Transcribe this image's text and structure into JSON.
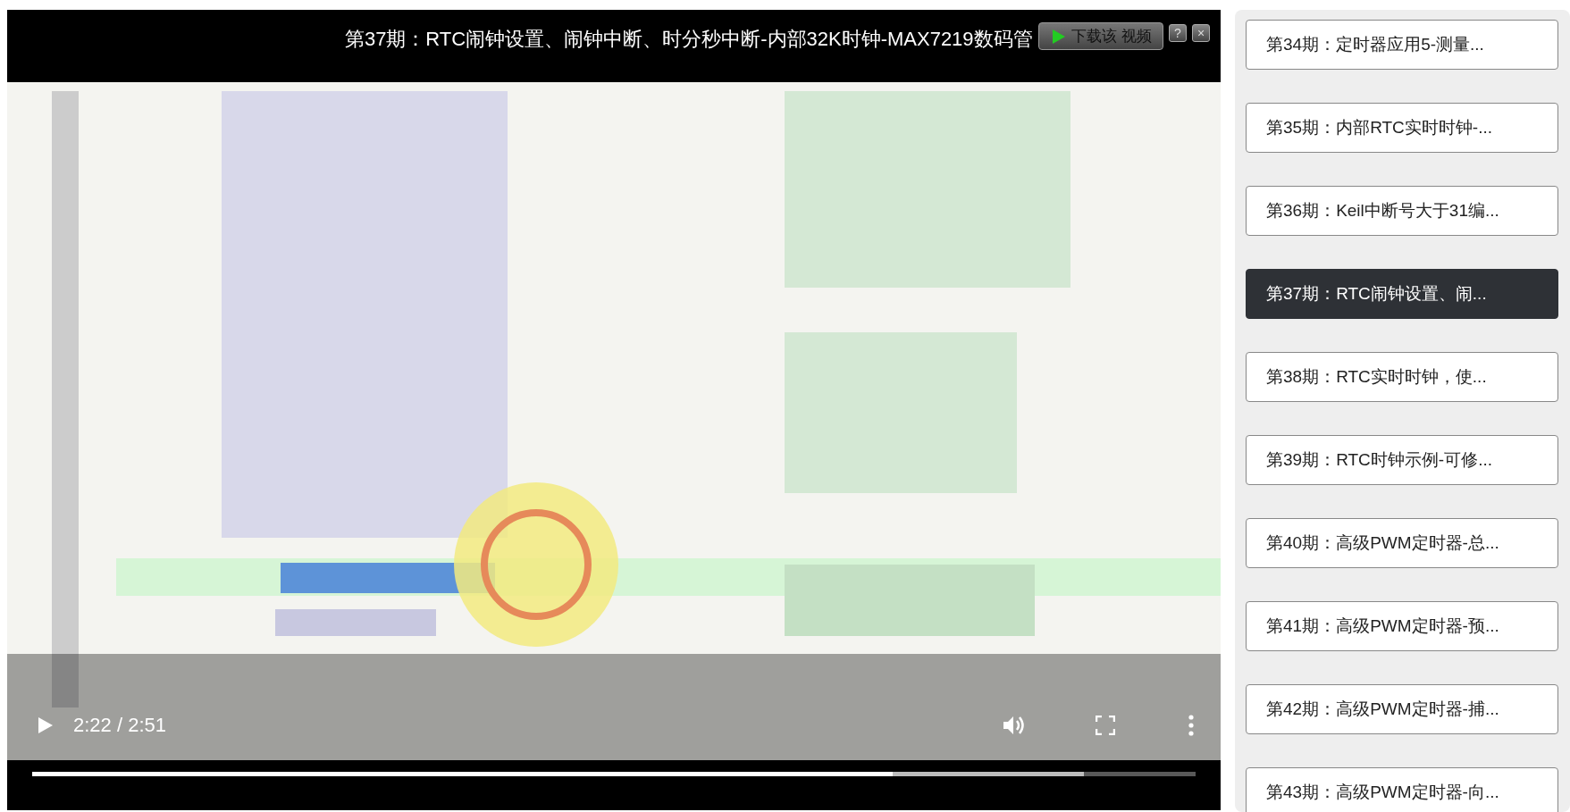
{
  "video": {
    "title": "第37期：RTC闹钟设置、闹钟中断、时分秒中断-内部32K时钟-MAX7219数码管",
    "download_button": "下载该 视频",
    "help_button": "?",
    "close_button": "×",
    "time": "2:22 / 2:51",
    "progress": {
      "level": 0.74
    },
    "buffered": {
      "level": 0.904
    }
  },
  "playlist": [
    {
      "label": "第34期：定时器应用5-测量...",
      "selected": false
    },
    {
      "label": "第35期：内部RTC实时时钟-...",
      "selected": false
    },
    {
      "label": "第36期：Keil中断号大于31编...",
      "selected": false
    },
    {
      "label": "第37期：RTC闹钟设置、闹...",
      "selected": true
    },
    {
      "label": "第38期：RTC实时时钟，使...",
      "selected": false
    },
    {
      "label": "第39期：RTC时钟示例-可修...",
      "selected": false
    },
    {
      "label": "第40期：高级PWM定时器-总...",
      "selected": false
    },
    {
      "label": "第41期：高级PWM定时器-预...",
      "selected": false
    },
    {
      "label": "第42期：高级PWM定时器-捕...",
      "selected": false
    },
    {
      "label": "第43期：高级PWM定时器-向...",
      "selected": false
    }
  ]
}
